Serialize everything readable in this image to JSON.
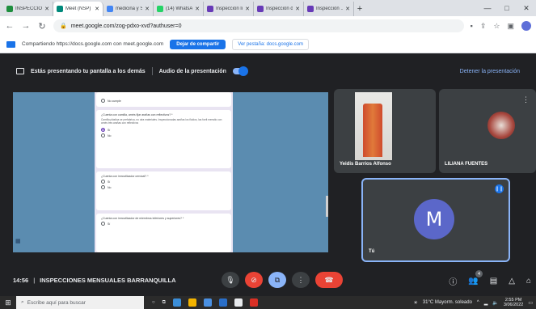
{
  "browser": {
    "tabs": [
      {
        "title": "INSPECCIONES | ...",
        "color": "#1e8e3e"
      },
      {
        "title": "Meet (NSP)",
        "color": "#00897b",
        "active": true
      },
      {
        "title": "medicina y Seg...",
        "color": "#4285f4"
      },
      {
        "title": "(14) WhatsApp",
        "color": "#25d366"
      },
      {
        "title": "Inspección lineu...",
        "color": "#673ab7"
      },
      {
        "title": "Inspección de co...",
        "color": "#673ab7"
      },
      {
        "title": "Inspección ...",
        "color": "#673ab7"
      }
    ],
    "new_tab": "+",
    "url": "meet.google.com/zog-pdxo-xvd?authuser=0",
    "share_message": "Compartiendo https://docs.google.com con meet.google.com",
    "stop_sharing": "Dejar de compartir",
    "switch_tab": "Ver pestaña: docs.google.com"
  },
  "meet": {
    "presenting_text": "Estás presentando tu pantalla a los demás",
    "audio_text": "Audio de la presentación",
    "stop_presenting": "Detener la presentación",
    "time": "14:56",
    "meeting_name": "INSPECCIONES MENSUALES BARRANQUILLA",
    "participants_badge": "4",
    "participants": [
      {
        "name": "Yeidis Barrios Alfonso"
      },
      {
        "name": "LILIANA FUENTES"
      },
      {
        "name": "Tú",
        "initial": "M",
        "avatar_color": "#5b67c9"
      }
    ]
  },
  "form": {
    "cards": [
      {
        "title": "",
        "options": [
          "No cumple"
        ]
      },
      {
        "title": "¿Cuenta con camilla, arnés fijar arañas con reflectivos? *",
        "desc": "Camilla plástica se prefabrica, no otra materiales. Inspeccionadas arañas los fluidos, las fuelt menstio con arnés tres arañas con reflectivos",
        "options": [
          "Sí",
          "No"
        ],
        "selected": 0
      },
      {
        "title": "¿Cuenta con inmovilizador cervical? *",
        "options": [
          "Sí",
          "No"
        ]
      },
      {
        "title": "¿Cuenta con inmovilizador de miembros inferiores y superiores? *",
        "options": [
          "Sí"
        ]
      }
    ]
  },
  "taskbar": {
    "search_placeholder": "Escribe aquí para buscar",
    "weather": "31°C Mayorm. soleado",
    "time": "2:55 PM",
    "date": "3/06/2022"
  }
}
